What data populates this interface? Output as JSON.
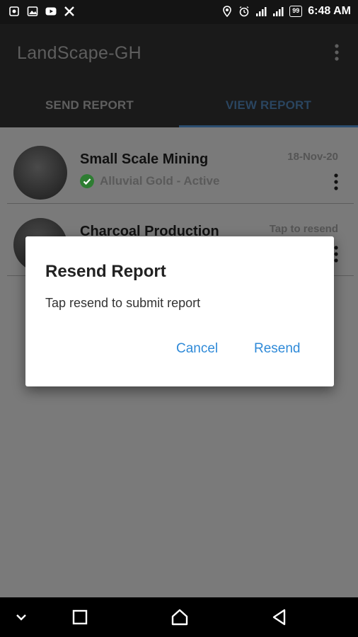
{
  "status_bar": {
    "time": "6:48 AM",
    "battery": "99",
    "icons": [
      "settings-sync-icon",
      "image-icon",
      "youtube-icon",
      "x-icon",
      "location-icon",
      "alarm-icon",
      "signal-icon",
      "signal-icon"
    ]
  },
  "app": {
    "title": "LandScape-GH"
  },
  "tabs": [
    {
      "label": "SEND REPORT",
      "active": false
    },
    {
      "label": "VIEW REPORT",
      "active": true
    }
  ],
  "reports": [
    {
      "title": "Small Scale Mining",
      "subtitle": "Alluvial Gold - Active",
      "meta": "18-Nov-20",
      "status_icon": "check-circle-icon"
    },
    {
      "title": "Charcoal Production",
      "subtitle": "",
      "meta": "Tap to resend",
      "status_icon": ""
    }
  ],
  "dialog": {
    "title": "Resend Report",
    "message": "Tap resend to submit report",
    "cancel_label": "Cancel",
    "confirm_label": "Resend"
  },
  "colors": {
    "accent": "#2f8ad8",
    "app_bar": "#1a1a1a",
    "scrim": "#7a7a7a",
    "active_status": "#2e7d32"
  }
}
